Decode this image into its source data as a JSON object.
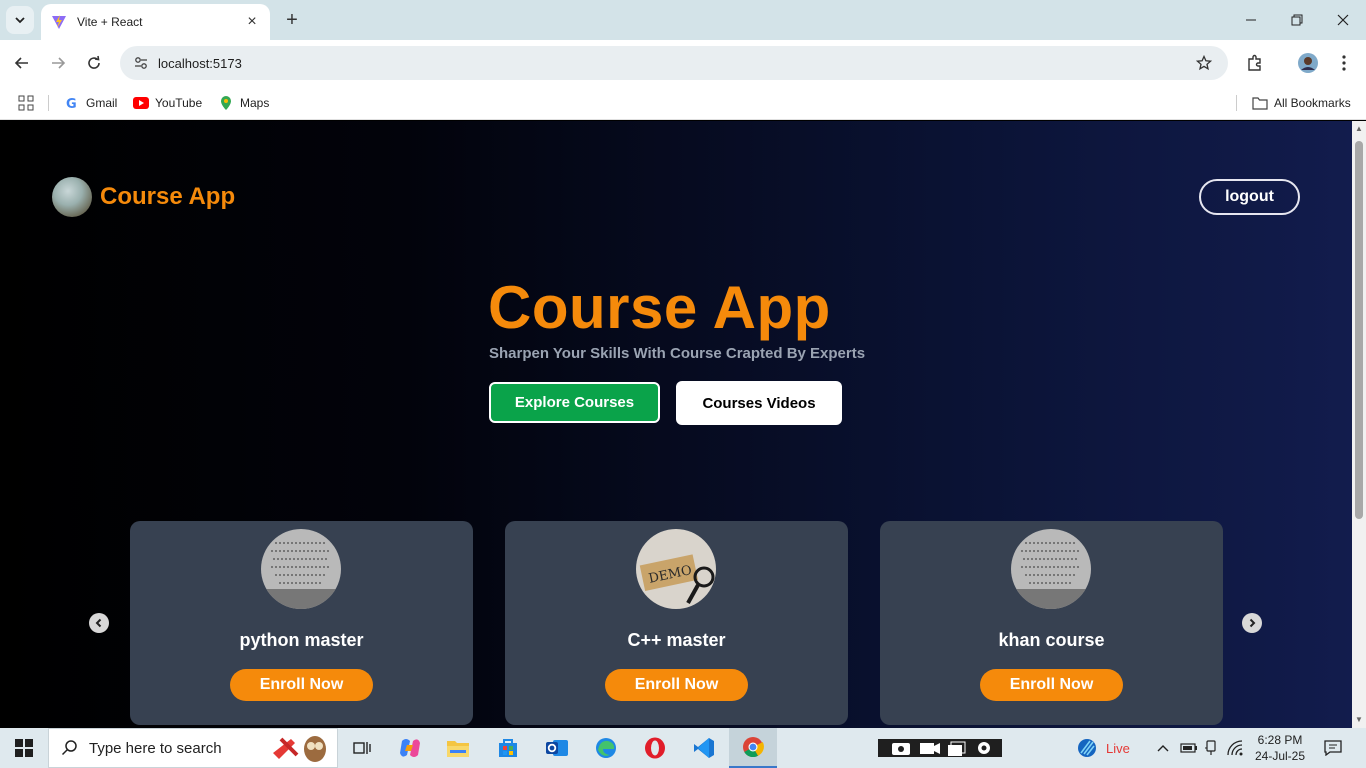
{
  "browser": {
    "tab_title": "Vite + React",
    "url": "localhost:5173",
    "bookmarks": [
      {
        "label": "Gmail",
        "icon": "gmail-icon"
      },
      {
        "label": "YouTube",
        "icon": "youtube-icon"
      },
      {
        "label": "Maps",
        "icon": "maps-icon"
      }
    ],
    "all_bookmarks": "All Bookmarks"
  },
  "header": {
    "brand": "Course App",
    "logout_label": "logout"
  },
  "hero": {
    "title": "Course App",
    "subtitle": "Sharpen Your Skills With Course Crapted By Experts",
    "explore_label": "Explore Courses",
    "videos_label": "Courses Videos"
  },
  "courses": [
    {
      "title": "python master",
      "button": "Enroll Now",
      "image": "code-pattern-image"
    },
    {
      "title": "C++ master",
      "button": "Enroll Now",
      "image": "demo-tag-image",
      "image_text": "DEMO"
    },
    {
      "title": "khan course",
      "button": "Enroll Now",
      "image": "code-pattern-image"
    }
  ],
  "taskbar": {
    "search_placeholder": "Type here to search",
    "live_label": "Live",
    "time": "6:28 PM",
    "date": "24-Jul-25"
  },
  "colors": {
    "accent": "#f58a0b",
    "explore_green": "#0aa34a",
    "card_bg": "#374151"
  }
}
